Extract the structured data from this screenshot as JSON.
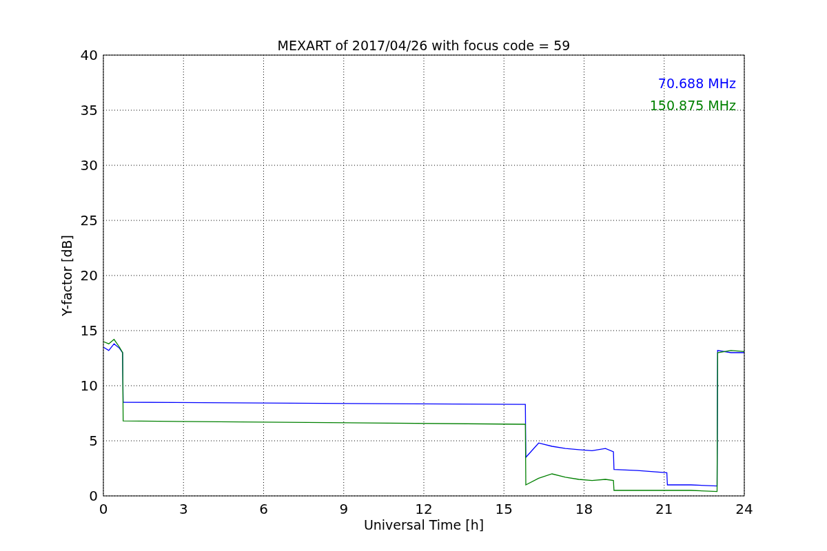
{
  "chart_data": {
    "type": "line",
    "title": "MEXART of 2017/04/26 with focus code = 59",
    "xlabel": "Universal Time [h]",
    "ylabel": "Y-factor [dB]",
    "x": [
      0,
      0.2,
      0.4,
      0.6,
      0.72,
      0.74,
      15.8,
      15.82,
      16.3,
      16.8,
      17.3,
      17.8,
      18.3,
      18.8,
      19.1,
      19.12,
      20,
      21.1,
      21.12,
      22,
      22.98,
      23.0,
      23.5,
      24
    ],
    "series": [
      {
        "name": "70.688 MHz",
        "color": "#0000ff",
        "values": [
          13.5,
          13.2,
          13.8,
          13.4,
          13,
          8.5,
          8.3,
          3.5,
          4.8,
          4.5,
          4.3,
          4.2,
          4.1,
          4.3,
          4.0,
          2.4,
          2.3,
          2.1,
          1.0,
          1.0,
          0.9,
          13.2,
          13.0,
          13.0
        ]
      },
      {
        "name": "150.875 MHz",
        "color": "#008000",
        "values": [
          14,
          13.8,
          14.2,
          13.5,
          13,
          6.8,
          6.5,
          1.0,
          1.6,
          2.0,
          1.7,
          1.5,
          1.4,
          1.5,
          1.4,
          0.5,
          0.5,
          0.5,
          0.5,
          0.5,
          0.4,
          13.0,
          13.2,
          13.1
        ]
      }
    ],
    "xlim": [
      0,
      24
    ],
    "ylim": [
      0,
      40
    ],
    "xticks": [
      0,
      3,
      6,
      9,
      12,
      15,
      18,
      21,
      24
    ],
    "yticks": [
      0,
      5,
      10,
      15,
      20,
      25,
      30,
      35,
      40
    ],
    "grid": true
  }
}
